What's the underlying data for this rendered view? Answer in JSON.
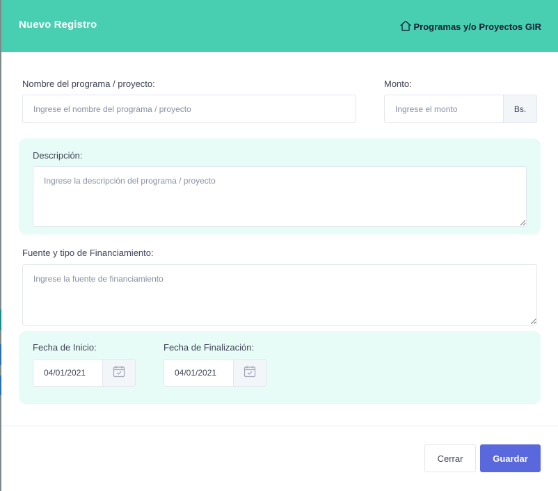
{
  "modal": {
    "title": "Nuevo Registro",
    "context_label": "Programas y/o Proyectos GIR",
    "context_icon": "home-outline-icon"
  },
  "form": {
    "nombre": {
      "label": "Nombre del programa / proyecto:",
      "placeholder": "Ingrese el nombre del programa / proyecto",
      "value": ""
    },
    "monto": {
      "label": "Monto:",
      "placeholder": "Ingrese el monto",
      "addon": "Bs.",
      "value": ""
    },
    "descripcion": {
      "label": "Descripción:",
      "placeholder": "Ingrese la descripción del programa / proyecto",
      "value": ""
    },
    "fuente": {
      "label": "Fuente y tipo de Financiamiento:",
      "placeholder": "Ingrese la fuente de financiamiento",
      "value": ""
    },
    "fecha_inicio": {
      "label": "Fecha de Inicio:",
      "value": "04/01/2021",
      "icon": "calendar-check-icon"
    },
    "fecha_fin": {
      "label": "Fecha de Finalización:",
      "value": "04/01/2021",
      "icon": "calendar-check-icon"
    }
  },
  "footer": {
    "close_label": "Cerrar",
    "save_label": "Guardar"
  },
  "colors": {
    "header_bg": "#48cfb1",
    "panel_bg": "#e8fcf7",
    "primary_button": "#5a68de"
  }
}
